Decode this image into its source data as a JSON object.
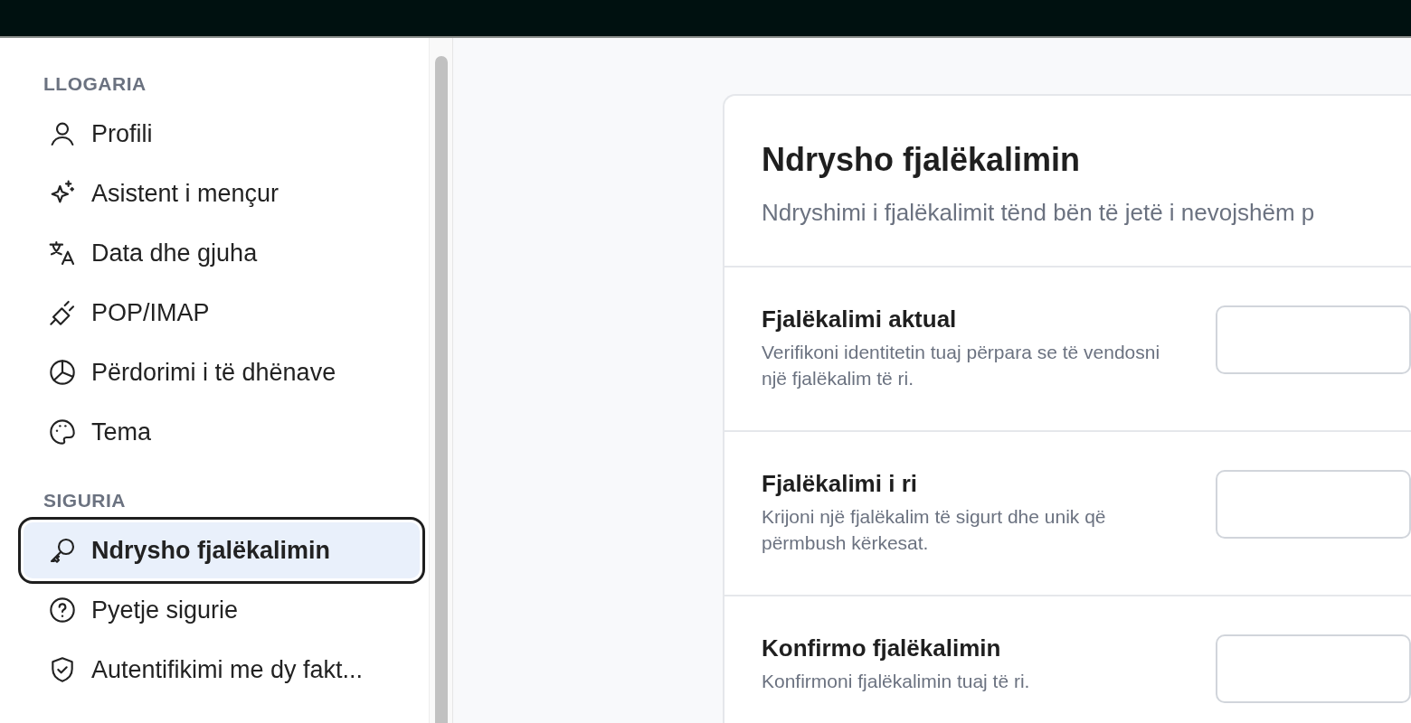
{
  "sidebar": {
    "sections": [
      {
        "heading": "LLOGARIA",
        "items": [
          {
            "label": "Profili",
            "selected": false
          },
          {
            "label": "Asistent i mençur",
            "selected": false
          },
          {
            "label": "Data dhe gjuha",
            "selected": false
          },
          {
            "label": "POP/IMAP",
            "selected": false
          },
          {
            "label": "Përdorimi i të dhënave",
            "selected": false
          },
          {
            "label": "Tema",
            "selected": false
          }
        ]
      },
      {
        "heading": "SIGURIA",
        "items": [
          {
            "label": "Ndrysho fjalëkalimin",
            "selected": true
          },
          {
            "label": "Pyetje sigurie",
            "selected": false
          },
          {
            "label": "Autentifikimi me dy fakt...",
            "selected": false
          }
        ]
      }
    ]
  },
  "card": {
    "title": "Ndrysho fjalëkalimin",
    "subtitle": "Ndryshimi i fjalëkalimit tënd bën të jetë i nevojshëm p",
    "fields": [
      {
        "label": "Fjalëkalimi aktual",
        "description": "Verifikoni identitetin tuaj përpara se të vendosni një fjalëkalim të ri."
      },
      {
        "label": "Fjalëkalimi i ri",
        "description": "Krijoni një fjalëkalim të sigurt dhe unik që përmbush kërkesat."
      },
      {
        "label": "Konfirmo fjalëkalimin",
        "description": "Konfirmoni fjalëkalimin tuaj të ri."
      }
    ]
  }
}
